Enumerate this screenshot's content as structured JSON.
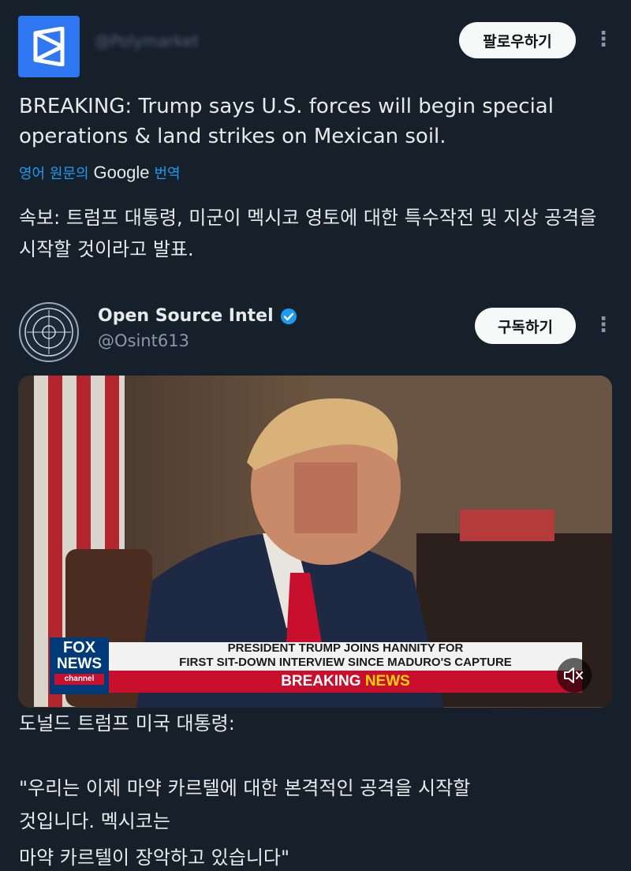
{
  "header": {
    "follow_label": "팔로우하기",
    "blurred_handle": "@Polymarket"
  },
  "tweet": {
    "text": "BREAKING: Trump says U.S. forces will begin special operations & land strikes on Mexican soil.",
    "translate_prefix": "영어 원문의",
    "translate_google": "Google",
    "translate_suffix": "번역",
    "translated_text": "속보: 트럼프 대통령, 미군이 멕시코 영토에 대한 특수작전 및 지상 공격을 시작할 것이라고 발표."
  },
  "quoted": {
    "name": "Open Source Intel",
    "handle": "@Osint613",
    "subscribe_label": "구독하기",
    "chyron_line1": "PRESIDENT TRUMP JOINS HANNITY FOR",
    "chyron_line2": "FIRST SIT-DOWN INTERVIEW SINCE MADURO'S CAPTURE",
    "chyron_breaking": "BREAKING",
    "chyron_news": "NEWS",
    "network_top": "FOX",
    "network_mid": "NEWS",
    "network_bottom": "channel",
    "body_line1": "도널드 트럼프 미국 대통령:",
    "body_line2": "\"우리는 이제 마약 카르텔에 대한 본격적인 공격을 시작할",
    "body_line3": "것입니다. 멕시코는",
    "body_line4": "마약 카르텔이 장악하고 있습니다\""
  },
  "colors": {
    "background": "#15202b",
    "accent_blue": "#1d9bf0",
    "verified": "#1d9bf0",
    "fox_red": "#c8102e",
    "breaking_yellow": "#ffd400"
  }
}
